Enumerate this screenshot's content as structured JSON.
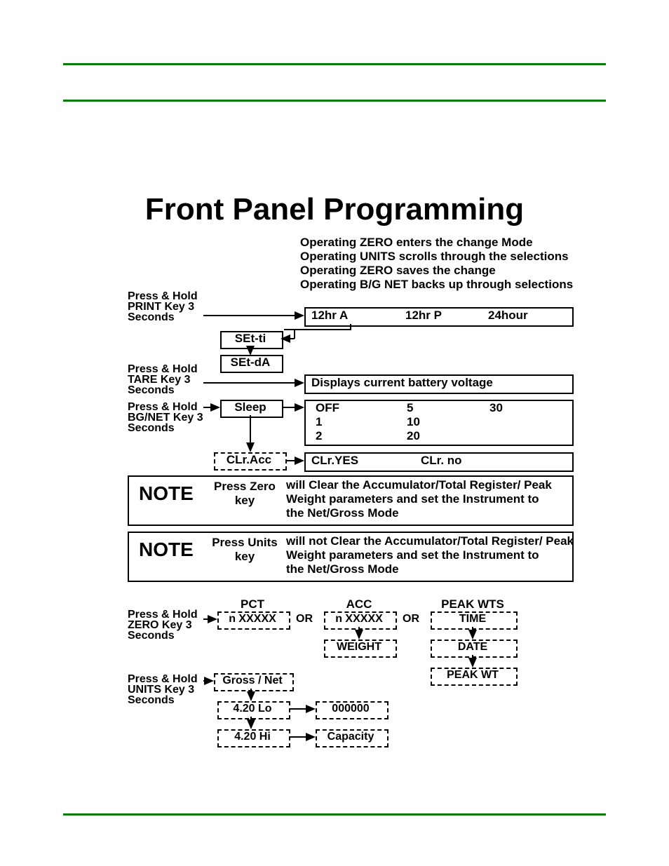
{
  "title": "Front Panel Programming",
  "intro": {
    "l1": "Operating ZERO enters the change Mode",
    "l2": "Operating UNITS scrolls through the selections",
    "l3": "Operating ZERO saves the change",
    "l4": "Operating B/G NET backs up through selections"
  },
  "act": {
    "print": {
      "l1": "Press & Hold",
      "l2": "PRINT Key 3",
      "l3": "Seconds"
    },
    "tare": {
      "l1": "Press & Hold",
      "l2": "TARE Key 3",
      "l3": "Seconds"
    },
    "bgnet": {
      "l1": "Press & Hold",
      "l2": "BG/NET Key 3",
      "l3": "Seconds"
    },
    "zero": {
      "l1": "Press & Hold",
      "l2": "ZERO Key 3",
      "l3": "Seconds"
    },
    "units": {
      "l1": "Press & Hold",
      "l2": "UNITS Key 3",
      "l3": "Seconds"
    }
  },
  "boxes": {
    "setti": "SEt-ti",
    "setda": "SEt-dA",
    "sleep": "Sleep",
    "clracc": "CLr.Acc",
    "grossnet": "Gross / Net",
    "lo420": "4.20 Lo",
    "hi420": "4.20 Hi",
    "zeros": "000000",
    "capacity": "Capacity",
    "nX1": "n XXXXX",
    "nX2": "n XXXXX",
    "weight": "WEIGHT",
    "time": "TIME",
    "date": "DATE",
    "peakwt": "PEAK WT"
  },
  "row": {
    "time": {
      "a": "12hr A",
      "b": "12hr P",
      "c": "24hour"
    },
    "batt": "Displays current battery voltage",
    "sleep": {
      "a": "OFF",
      "b": "5",
      "c": "30",
      "d": "1",
      "e": "10",
      "f": "2",
      "g": "20"
    },
    "clr": {
      "yes": "CLr.YES",
      "no": "CLr. no"
    }
  },
  "cols": {
    "pct": "PCT",
    "acc": "ACC",
    "peakwts": "PEAK WTS"
  },
  "or": "OR",
  "note1": {
    "label": "NOTE",
    "key": "Press Zero\nkey",
    "text": "will Clear the Accumulator/Total Register/ Peak\nWeight parameters and set the Instrument to\nthe Net/Gross Mode"
  },
  "note2": {
    "label": "NOTE",
    "key": "Press Units\nkey",
    "text": "will not Clear the Accumulator/Total Register/ Peak\nWeight parameters and set the Instrument to\nthe Net/Gross Mode"
  }
}
